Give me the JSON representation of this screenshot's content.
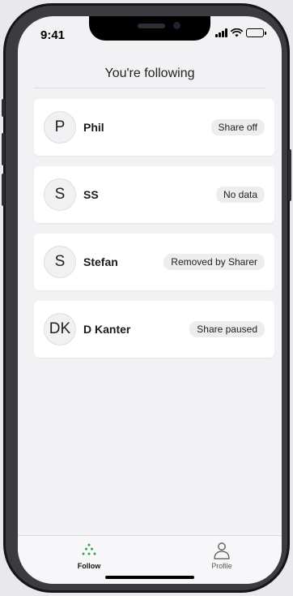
{
  "status_bar": {
    "time": "9:41",
    "icons": [
      "cellular-signal-icon",
      "wifi-icon",
      "battery-icon"
    ]
  },
  "header": {
    "title": "You're following"
  },
  "following": [
    {
      "initials": "P",
      "name": "Phil",
      "status": "Share off"
    },
    {
      "initials": "S",
      "name": "SS",
      "status": "No data"
    },
    {
      "initials": "S",
      "name": "Stefan",
      "status": "Removed by Sharer"
    },
    {
      "initials": "DK",
      "name": "D Kanter",
      "status": "Share paused"
    }
  ],
  "tabbar": {
    "follow_label": "Follow",
    "profile_label": "Profile",
    "follow_icon": "dots-cluster-icon",
    "profile_icon": "person-icon"
  },
  "colors": {
    "accent_green": "#2e9e4a",
    "card_background": "#ffffff",
    "screen_background": "#f2f2f4",
    "badge_background": "#ededef"
  }
}
